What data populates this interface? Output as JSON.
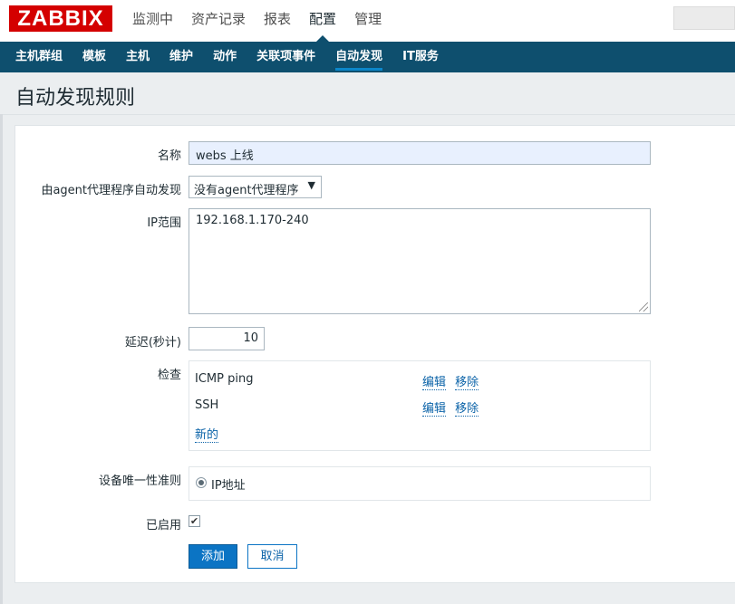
{
  "header": {
    "logo": "ZABBIX",
    "nav": [
      "监测中",
      "资产记录",
      "报表",
      "配置",
      "管理"
    ],
    "active_nav": 3
  },
  "subnav": {
    "items": [
      "主机群组",
      "模板",
      "主机",
      "维护",
      "动作",
      "关联项事件",
      "自动发现",
      "IT服务"
    ],
    "active": 6
  },
  "page": {
    "title": "自动发现规则"
  },
  "form": {
    "name_label": "名称",
    "name_value": "webs 上线",
    "proxy_label": "由agent代理程序自动发现",
    "proxy_value": "没有agent代理程序",
    "ip_label": "IP范围",
    "ip_value": "192.168.1.170-240",
    "delay_label": "延迟(秒计)",
    "delay_value": "10",
    "checks_label": "检查",
    "checks": [
      {
        "name": "ICMP ping",
        "edit": "编辑",
        "remove": "移除"
      },
      {
        "name": "SSH",
        "edit": "编辑",
        "remove": "移除"
      }
    ],
    "new_link": "新的",
    "uniq_label": "设备唯一性准则",
    "uniq_option": "IP地址",
    "enabled_label": "已启用",
    "add_button": "添加",
    "cancel_button": "取消"
  },
  "colors": {
    "brand": "#d40000",
    "subnav_bg": "#0e4f6e",
    "primary": "#0b74c4"
  }
}
